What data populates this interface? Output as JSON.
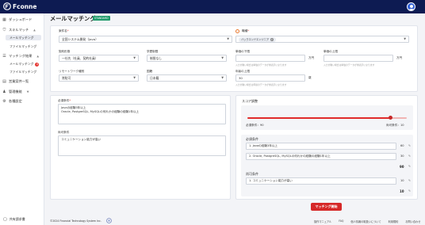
{
  "app": {
    "brand": "Fconne"
  },
  "sidebar": {
    "dashboard": "ダッシュボード",
    "skill_match": "スキルマッチ",
    "skill_sub1": "メールマッチング",
    "skill_sub2": "ファイルマッチング",
    "match_result": "マッチング結果",
    "result_sub1": "メールマッチング",
    "result_sub1_badge": "4",
    "result_sub2": "ファイルマッチング",
    "sales_list": "営業案件一覧",
    "management": "管理機能",
    "settings": "各種設定",
    "footer_link": "共有請求書"
  },
  "page": {
    "title": "メールマッチング",
    "badge": "STANDARD"
  },
  "form": {
    "project_label": "案件名",
    "project_value": "全国システム開発（Java）",
    "job_label": "職種",
    "job_chip": "バックエンドエンジニア",
    "contract_label": "契約形態",
    "contract_value": "一社先（社員、契約社員）",
    "education_label": "学歴制限",
    "education_value": "制限なし",
    "min_price_label": "単価の下限",
    "min_price_hint": "入力が無い場合は単価のデータが非表示になります",
    "max_price_label": "単価の上限",
    "max_price_hint": "入力が無い場合は単価のデータが非表示になります",
    "price_unit": "万円",
    "remote_label": "リモートワーク種別",
    "remote_value": "常駐可",
    "nationality_label": "国籍",
    "nationality_value": "日本籍",
    "age_label": "年齢の上限",
    "age_value": "30",
    "age_unit": "歳",
    "age_hint": "入力が無い場合は年齢のデータが非表示になります"
  },
  "conditions": {
    "required_label": "必須条件",
    "required_text": "Javaの経験3年以上\nOracle, PostgreSQL, MySQLの何れかの経験の経験1年以上",
    "preferred_label": "尚可条件",
    "preferred_text": "コミュニケーション能力が高い"
  },
  "score": {
    "title": "スコア調整",
    "required_weight_label": "必須条件：90",
    "preferred_weight_label": "尚可条件：10",
    "slider_value": 0.9,
    "required_section": "必須条件",
    "required_items": [
      {
        "text": "1. Javaの経験3年以上",
        "value": "60"
      },
      {
        "text": "2. Oracle, PostgreSQL, MySQLの何れかの経験の経験1年以上",
        "value": "30"
      }
    ],
    "required_total": "90",
    "preferred_section": "尚可条件",
    "preferred_items": [
      {
        "text": "1. コミュニケーション能力が高い",
        "value": "10"
      }
    ],
    "preferred_total": "10",
    "unit": "点"
  },
  "actions": {
    "start": "マッチング開始"
  },
  "footer": {
    "copyright": "©2024 Financial Technology System Inc.",
    "links": [
      "操作マニュアル",
      "FAQ",
      "個人情報の取扱いについて",
      "利用規約",
      "お問い合わせ"
    ]
  },
  "colors": {
    "navy": "#0d1b52",
    "accent_red": "#d62828",
    "badge_green": "#1f9a6b"
  }
}
